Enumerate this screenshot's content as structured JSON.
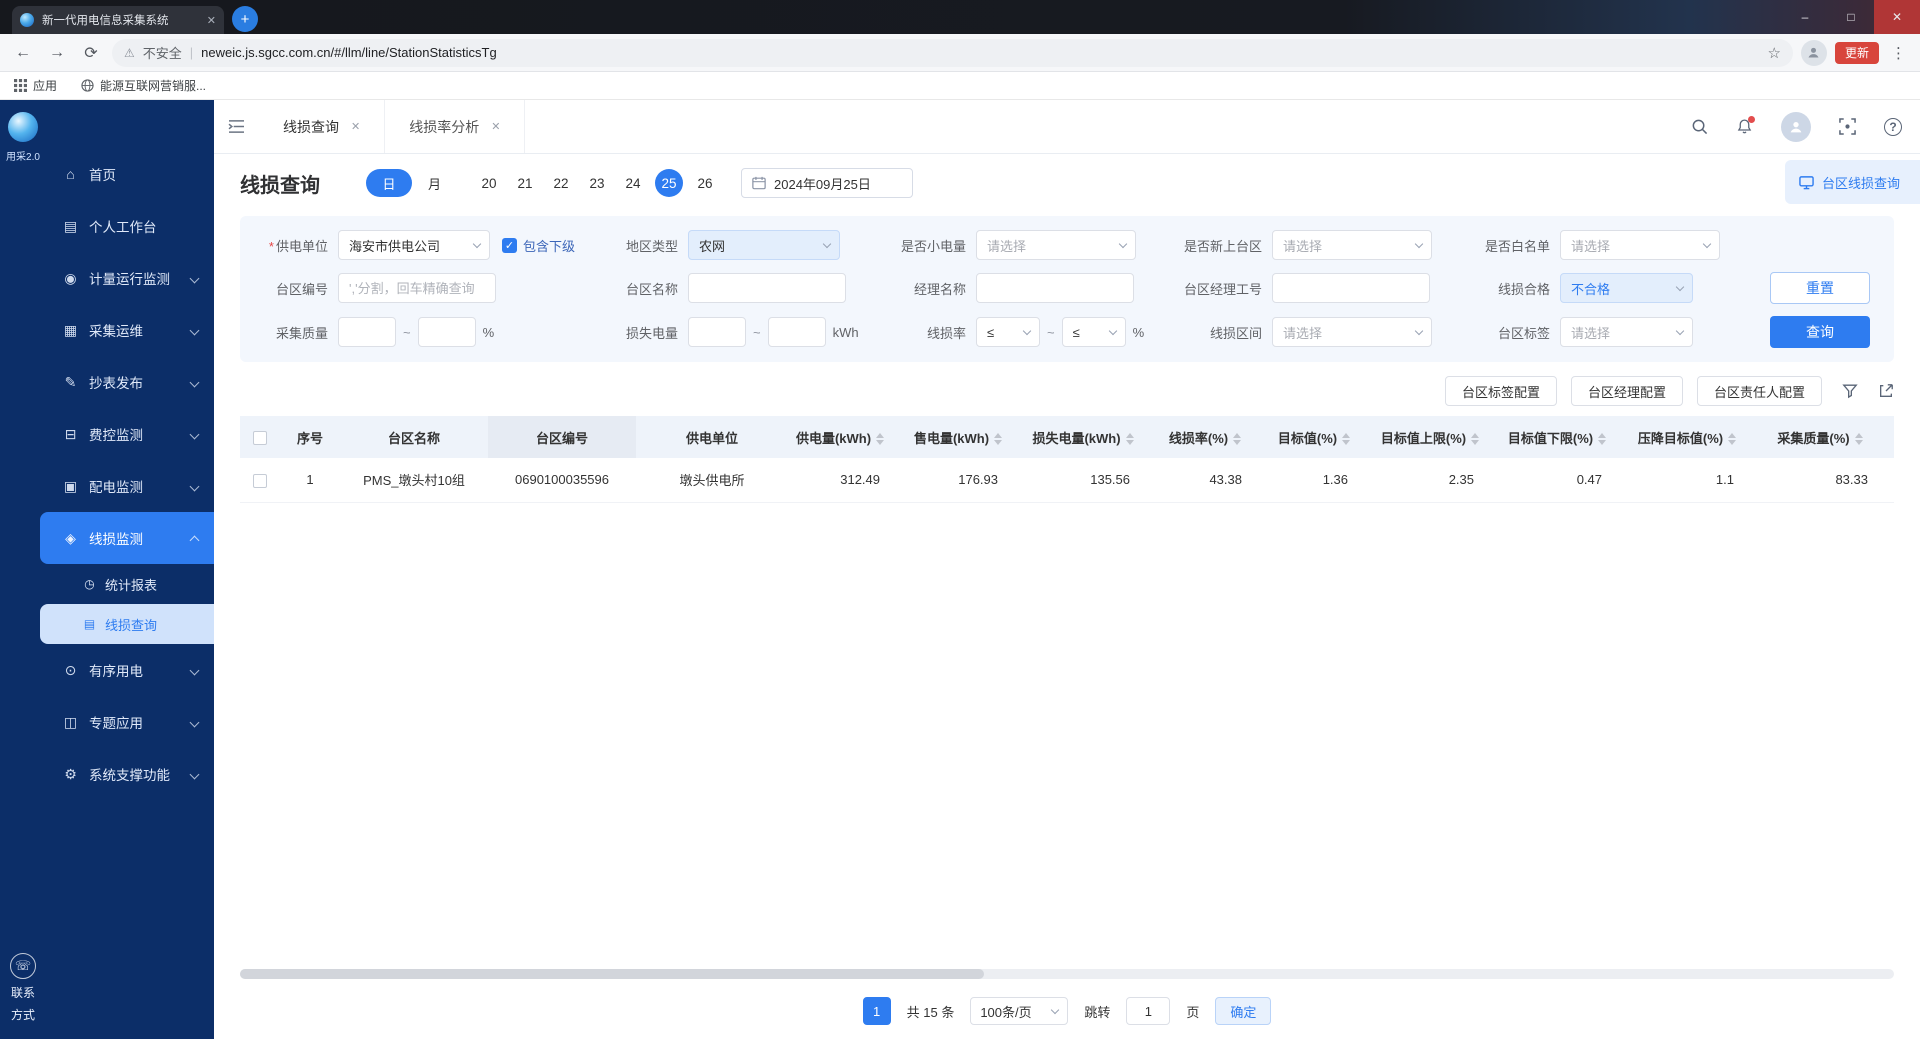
{
  "window": {
    "tab_title": "新一代用电信息采集系统"
  },
  "browser": {
    "security_label": "不安全",
    "url": "neweic.js.sgcc.com.cn/#/llm/line/StationStatisticsTg",
    "update_label": "更新",
    "bookmark_apps": "应用",
    "bookmark_site": "能源互联网营销服..."
  },
  "icons": {
    "back": "←",
    "forward": "→",
    "reload": "⟳",
    "star": "☆",
    "warning": "⚠",
    "dots": "⋮",
    "plus": "+",
    "minimize": "–",
    "maximize": "□",
    "close": "✕",
    "tab_close": "✕",
    "home": "⌂",
    "workbench": "▤",
    "metering": "◉",
    "collection": "▦",
    "meter_reading": "✎",
    "fee_control": "⊟",
    "distribution": "▣",
    "line_loss": "◈",
    "orderly": "⊙",
    "special": "◫",
    "system": "⚙",
    "stats": "◷",
    "query_menu": "▤",
    "phone": "☏",
    "check": "✓",
    "help": "?"
  },
  "sidebar": {
    "logo_text": "用采2.0",
    "items": [
      {
        "label": "首页"
      },
      {
        "label": "个人工作台"
      },
      {
        "label": "计量运行监测"
      },
      {
        "label": "采集运维"
      },
      {
        "label": "抄表发布"
      },
      {
        "label": "费控监测"
      },
      {
        "label": "配电监测"
      },
      {
        "label": "线损监测"
      },
      {
        "label": "有序用电"
      },
      {
        "label": "专题应用"
      },
      {
        "label": "系统支撑功能"
      }
    ],
    "subitems": [
      {
        "label": "统计报表"
      },
      {
        "label": "线损查询"
      }
    ],
    "contact": {
      "line1": "联系",
      "line2": "方式"
    }
  },
  "tabs": {
    "tab1": "线损查询",
    "tab2": "线损率分析"
  },
  "header": {
    "title": "线损查询",
    "day": "日",
    "month": "月",
    "days": [
      "20",
      "21",
      "22",
      "23",
      "24",
      "25",
      "26"
    ],
    "date": "2024年09月25日",
    "corner": "台区线损查询"
  },
  "filters": {
    "required_mark": "*",
    "tilde": "~",
    "units": {
      "percent": "%",
      "kwh": "kWh"
    },
    "supply_unit": {
      "label": "供电单位",
      "value": "海安市供电公司"
    },
    "include_sub": "包含下级",
    "region_type": {
      "label": "地区类型",
      "value": "农网"
    },
    "small_power": {
      "label": "是否小电量",
      "value": "请选择"
    },
    "new_station": {
      "label": "是否新上台区",
      "value": "请选择"
    },
    "whitelist": {
      "label": "是否白名单",
      "value": "请选择"
    },
    "station_no": {
      "label": "台区编号",
      "placeholder": "','分割，回车精确查询"
    },
    "station_name": {
      "label": "台区名称"
    },
    "manager_name": {
      "label": "经理名称"
    },
    "manager_id": {
      "label": "台区经理工号"
    },
    "loss_qualified": {
      "label": "线损合格",
      "value": "不合格"
    },
    "collect_quality": {
      "label": "采集质量"
    },
    "loss_energy": {
      "label": "损失电量"
    },
    "loss_rate": {
      "label": "线损率",
      "op": "≤"
    },
    "loss_range": {
      "label": "线损区间",
      "value": "请选择"
    },
    "station_tag": {
      "label": "台区标签",
      "value": "请选择"
    },
    "reset": "重置",
    "query": "查询"
  },
  "toolbar": {
    "btn_tag_config": "台区标签配置",
    "btn_manager_config": "台区经理配置",
    "btn_owner_config": "台区责任人配置"
  },
  "table": {
    "columns": [
      "序号",
      "台区名称",
      "台区编号",
      "供电单位",
      "供电量(kWh)",
      "售电量(kWh)",
      "损失电量(kWh)",
      "线损率(%)",
      "目标值(%)",
      "目标值上限(%)",
      "目标值下限(%)",
      "压降目标值(%)",
      "采集质量(%)"
    ],
    "rows": [
      {
        "seq": "1",
        "name": "PMS_墩头村10组",
        "code": "0690100035596",
        "unit": "墩头供电所",
        "supply": "312.49",
        "sale": "176.93",
        "loss": "135.56",
        "loss_rate": "43.38",
        "target": "1.36",
        "target_up": "2.35",
        "target_down": "0.47",
        "drop_target": "1.1",
        "quality": "83.33"
      }
    ]
  },
  "pagination": {
    "page": "1",
    "total": "共 15 条",
    "page_size": "100条/页",
    "jump": "跳转",
    "jump_value": "1",
    "unit": "页",
    "confirm": "确定"
  }
}
